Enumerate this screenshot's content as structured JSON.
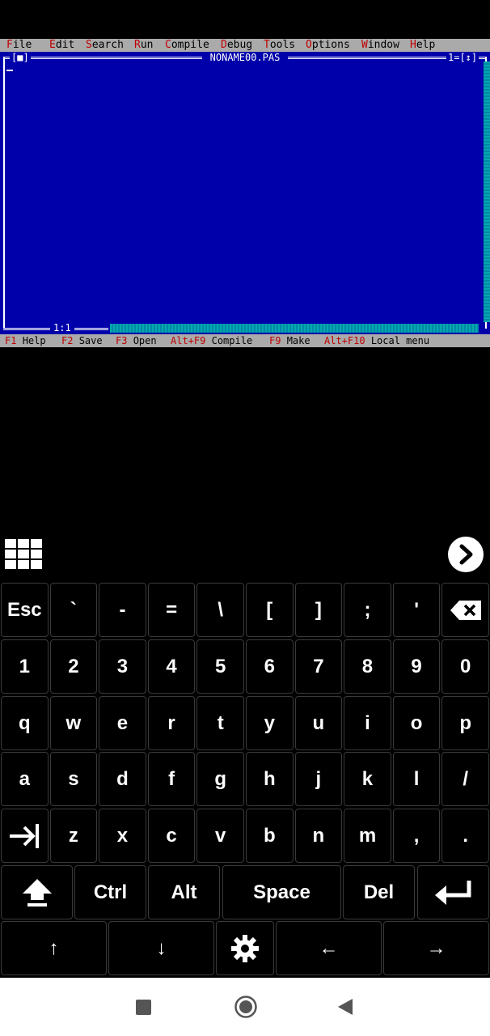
{
  "menubar": {
    "items": [
      {
        "hot": "F",
        "rest": "ile"
      },
      {
        "hot": "E",
        "rest": "dit"
      },
      {
        "hot": "S",
        "rest": "earch"
      },
      {
        "hot": "R",
        "rest": "un"
      },
      {
        "hot": "C",
        "rest": "ompile"
      },
      {
        "hot": "D",
        "rest": "ebug"
      },
      {
        "hot": "T",
        "rest": "ools"
      },
      {
        "hot": "O",
        "rest": "ptions"
      },
      {
        "hot": "W",
        "rest": "indow"
      },
      {
        "hot": "H",
        "rest": "elp"
      }
    ]
  },
  "editor": {
    "close_box": "[■]",
    "title": "NONAME00.PAS",
    "window_number": "1=[↕]",
    "position": "1:1"
  },
  "statusbar": {
    "items": [
      {
        "key": "F1",
        "label": "Help"
      },
      {
        "key": "F2",
        "label": "Save"
      },
      {
        "key": "F3",
        "label": "Open"
      },
      {
        "key": "Alt+F9",
        "label": "Compile"
      },
      {
        "key": "F9",
        "label": "Make"
      },
      {
        "key": "Alt+F10",
        "label": "Local menu"
      }
    ]
  },
  "keyboard": {
    "row1": [
      "Esc",
      "`",
      "-",
      "=",
      "\\",
      "[",
      "]",
      ";",
      "'",
      ""
    ],
    "row2": [
      "1",
      "2",
      "3",
      "4",
      "5",
      "6",
      "7",
      "8",
      "9",
      "0"
    ],
    "row3": [
      "q",
      "w",
      "e",
      "r",
      "t",
      "y",
      "u",
      "i",
      "o",
      "p"
    ],
    "row4": [
      "a",
      "s",
      "d",
      "f",
      "g",
      "h",
      "j",
      "k",
      "l",
      "/"
    ],
    "row5": [
      "",
      "z",
      "x",
      "c",
      "v",
      "b",
      "n",
      "m",
      ",",
      "."
    ],
    "row6": [
      "",
      "Ctrl",
      "Alt",
      "Space",
      "Del",
      ""
    ],
    "row7": [
      "↑",
      "↓",
      "",
      "←",
      "→"
    ]
  },
  "colors": {
    "editor_bg": "#0000aa",
    "menu_bg": "#aaaaaa",
    "hotkey": "#c00000",
    "scrollbar": "#00aaaa"
  }
}
